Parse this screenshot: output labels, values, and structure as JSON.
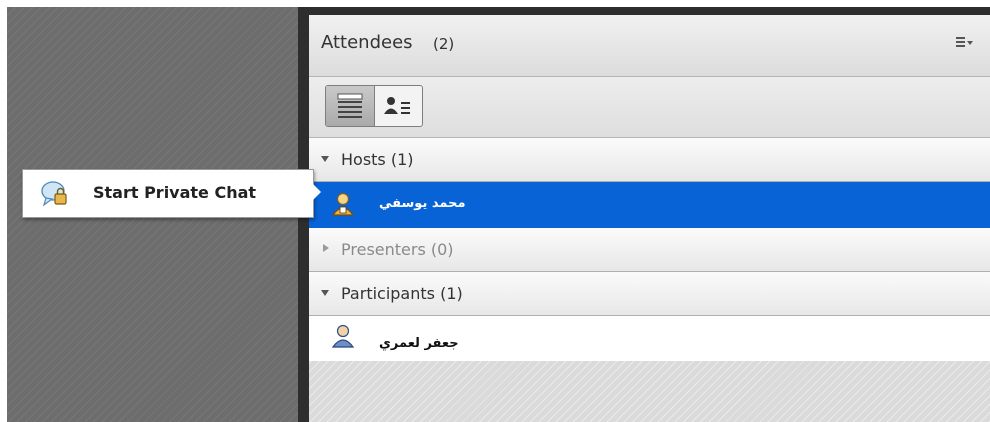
{
  "pod": {
    "title": "Attendees",
    "count": "(2)",
    "menu_icon": "pod-options-menu-icon"
  },
  "toolbar": {
    "list_view_icon": "list-view-icon",
    "status_view_icon": "attendee-status-view-icon"
  },
  "groups": {
    "hosts": {
      "label": "Hosts (1)",
      "expanded": true
    },
    "presenters": {
      "label": "Presenters (0)",
      "expanded": false
    },
    "participants": {
      "label": "Participants (1)",
      "expanded": true
    }
  },
  "users": {
    "host": {
      "name": "محمد يوسفي",
      "role_icon": "host-user-icon",
      "selected": true
    },
    "participant": {
      "name": "جعفر لعمري",
      "role_icon": "participant-user-icon",
      "selected": false
    }
  },
  "context_menu": {
    "item_label": "Start Private Chat",
    "item_icon": "private-chat-lock-icon"
  },
  "colors": {
    "selection": "#0863d6",
    "left_panel": "#6d6d6d",
    "frame": "#2e2e2e"
  }
}
